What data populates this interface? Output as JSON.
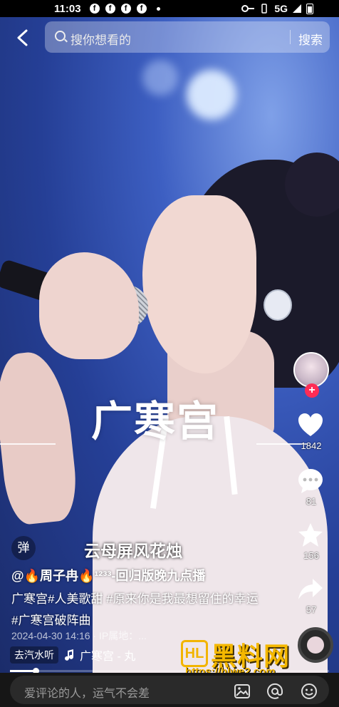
{
  "status_bar": {
    "time": "11:03",
    "app_icons": [
      "f",
      "f",
      "f",
      "f"
    ],
    "network": "5G"
  },
  "search": {
    "placeholder": "搜你想看的",
    "button_label": "搜索"
  },
  "video": {
    "title_overlay": "广寒宫",
    "lyric": "云母屏风花烛",
    "danmaku_label": "弹"
  },
  "rail": {
    "like_count": "1842",
    "comment_count": "81",
    "favorite_count": "156",
    "share_count": "57"
  },
  "post": {
    "author": "@🔥周子冉🔥¹²³³-回归版晚九点播",
    "desc_line1": "广寒宫#人美歌甜 #原来你是我最想留住的幸运",
    "desc_line2": "#广寒宫破阵曲",
    "date": "2024-04-30 14:16 · IP属地：..."
  },
  "music": {
    "tag": "去汽水听",
    "name": "广寒宫 - 丸"
  },
  "playback": {
    "progress": 0.08
  },
  "watermark": {
    "brand": "黑料网",
    "url": "https://hlwe2.com"
  },
  "comment_bar": {
    "placeholder": "爱评论的人，运气不会差"
  },
  "icons": {
    "back": "chevron-left-icon",
    "search": "search-icon",
    "like": "heart-icon",
    "comment": "comment-icon",
    "favorite": "star-icon",
    "share": "share-icon",
    "image": "image-icon",
    "mention": "at-icon",
    "emoji": "emoji-icon"
  }
}
